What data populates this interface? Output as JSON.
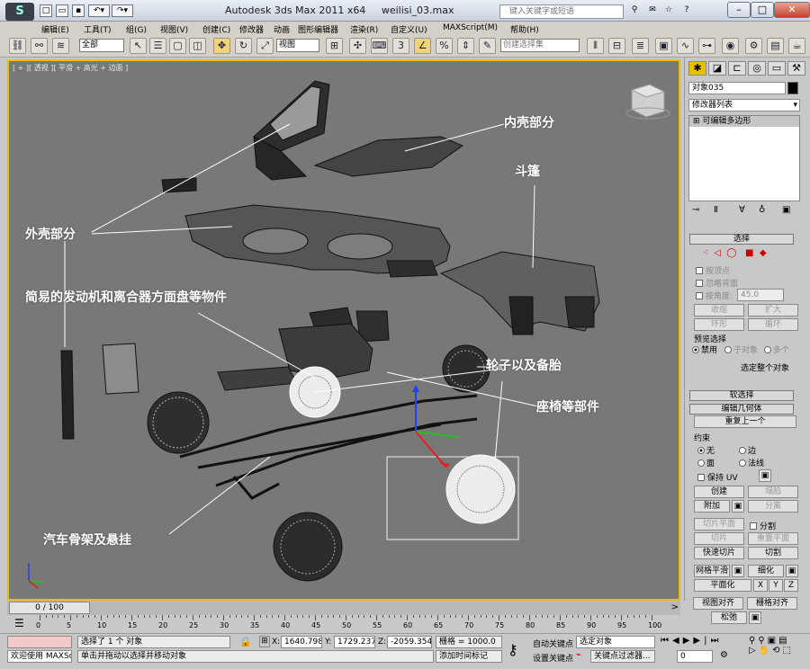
{
  "window": {
    "app_title": "Autodesk 3ds Max  2011 x64",
    "file_name": "weilisi_03.max",
    "search_placeholder": "键入关键字或短语",
    "logo_text": "S"
  },
  "menu": [
    "编辑(E)",
    "工具(T)",
    "组(G)",
    "视图(V)",
    "创建(C)",
    "修改器",
    "动画",
    "图形编辑器",
    "渲染(R)",
    "自定义(U)",
    "MAXScript(M)",
    "帮助(H)"
  ],
  "toolbar": {
    "selection_filter": "全部",
    "ref_coord": "视图",
    "named_selection": "创建选择集"
  },
  "viewport": {
    "label": "[ + ][ 透视 ][ 平滑 + 高光 + 边面 ]",
    "annotations": {
      "inner_shell": "内壳部分",
      "hood": "斗篷",
      "outer_shell": "外壳部分",
      "engine": "简易的发动机和离合器方面盘等物件",
      "wheels": "轮子以及备胎",
      "seats": "座椅等部件",
      "chassis": "汽车骨架及悬挂"
    }
  },
  "command_panel": {
    "tabs": [
      "create-icon",
      "modify-icon",
      "hierarchy-icon",
      "motion-icon",
      "display-icon",
      "utilities-icon"
    ],
    "object_name": "对象035",
    "modifier_list": "修改器列表",
    "stack_item": "可编辑多边形",
    "select_rollout": {
      "title": "选择",
      "by_vertex": "按顶点",
      "ignore_backface": "忽略背面",
      "by_angle": "按角度:",
      "angle_value": "45.0",
      "shrink": "收缩",
      "grow": "扩大",
      "ring": "环形",
      "loop": "循环",
      "preview_title": "预览选择",
      "disable": "禁用",
      "sub_object": "子对象",
      "multi": "多个",
      "select_whole": "选定整个对象"
    },
    "soft_select": "软选择",
    "edit_geometry": {
      "title": "编辑几何体",
      "repeat_last": "重复上一个",
      "constraint_title": "约束",
      "none": "无",
      "edge": "边",
      "face": "面",
      "normal": "法线",
      "keep_uv": "保持 UV",
      "create": "创建",
      "collapse": "塌陷",
      "attach": "附加",
      "detach": "分离",
      "slice_plane": "切片平面",
      "split": "分割",
      "slice": "切片",
      "reset_plane": "重置平面",
      "quickslice": "快速切片",
      "cut": "切割",
      "meshsmooth": "网格平滑",
      "tessellate": "细化",
      "planarize": "平面化",
      "x": "X",
      "y": "Y",
      "z": "Z",
      "view_align": "视图对齐",
      "grid_align": "栅格对齐",
      "relax": "松弛"
    }
  },
  "timeline": {
    "frame_label": "0 / 100",
    "ticks": [
      "0",
      "5",
      "10",
      "15",
      "20",
      "25",
      "30",
      "35",
      "40",
      "45",
      "50",
      "55",
      "60",
      "65",
      "70",
      "75",
      "80",
      "85",
      "90",
      "95",
      "100"
    ]
  },
  "status": {
    "maxscript_label": "欢迎使用 MAXSc",
    "selected": "选择了 1 个 对象",
    "prompt": "单击并拖动以选择并移动对象",
    "x_label": "X:",
    "x": "1640.798",
    "y_label": "Y:",
    "y": "1729.237",
    "z_label": "Z:",
    "z": "-2059.354",
    "grid": "栅格 = 1000.0",
    "add_time_tag": "添加时间标记",
    "auto_key": "自动关键点",
    "auto_key_value": "选定对象",
    "set_key": "设置关键点",
    "key_filters": "关键点过滤器...",
    "frame": "0"
  }
}
